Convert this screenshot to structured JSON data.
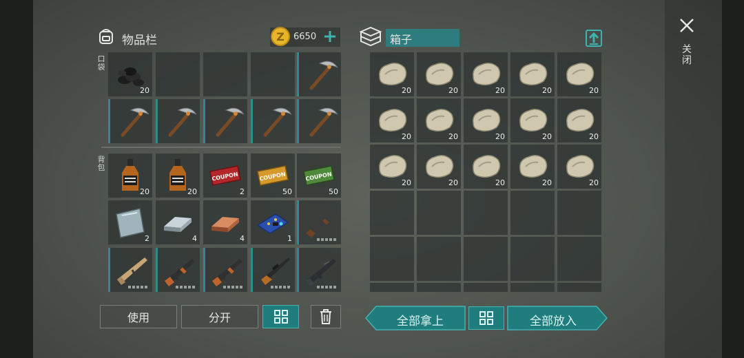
{
  "inventory": {
    "title": "物品栏",
    "coins": "6650",
    "pocket_label": "口袋",
    "backpack_label": "背包",
    "pocket": [
      {
        "icon": "coal-icon",
        "qty": "20",
        "accent": false
      },
      {
        "icon": "empty",
        "qty": "",
        "accent": false
      },
      {
        "icon": "empty",
        "qty": "",
        "accent": false
      },
      {
        "icon": "empty",
        "qty": "",
        "accent": false
      },
      {
        "icon": "pickaxe-icon",
        "qty": "",
        "accent": true
      },
      {
        "icon": "pickaxe-icon",
        "qty": "",
        "accent": true
      },
      {
        "icon": "pickaxe-icon",
        "qty": "",
        "accent": true
      },
      {
        "icon": "pickaxe-icon",
        "qty": "",
        "accent": true
      },
      {
        "icon": "pickaxe-icon",
        "qty": "",
        "accent": true
      },
      {
        "icon": "pickaxe-icon",
        "qty": "",
        "accent": true
      }
    ],
    "backpack": [
      {
        "icon": "whiskey-bottle-icon",
        "qty": "20",
        "accent": false
      },
      {
        "icon": "whiskey-bottle-icon",
        "qty": "20",
        "accent": false
      },
      {
        "icon": "red-coupon-icon",
        "qty": "2",
        "accent": false
      },
      {
        "icon": "orange-coupon-icon",
        "qty": "50",
        "accent": false
      },
      {
        "icon": "green-coupon-icon",
        "qty": "50",
        "accent": false
      },
      {
        "icon": "metal-plate-icon",
        "qty": "2",
        "accent": false
      },
      {
        "icon": "iron-ingot-icon",
        "qty": "4",
        "accent": false
      },
      {
        "icon": "copper-ingot-icon",
        "qty": "4",
        "accent": false
      },
      {
        "icon": "circuit-board-icon",
        "qty": "1",
        "accent": false
      },
      {
        "icon": "shotgun-icon",
        "qty": "",
        "accent": true,
        "dots": true
      },
      {
        "icon": "rifle-tan-icon",
        "qty": "",
        "accent": true,
        "dots": true
      },
      {
        "icon": "ak-rifle-icon",
        "qty": "",
        "accent": true,
        "dots": true
      },
      {
        "icon": "ak-rifle-icon",
        "qty": "",
        "accent": true,
        "dots": true
      },
      {
        "icon": "hunting-rifle-icon",
        "qty": "",
        "accent": true,
        "dots": true
      },
      {
        "icon": "assault-rifle-icon",
        "qty": "",
        "accent": true,
        "dots": true
      }
    ],
    "coupon_text": "COUPON"
  },
  "chest": {
    "title": "箱子",
    "items": [
      {
        "icon": "stone-icon",
        "qty": "20"
      },
      {
        "icon": "stone-icon",
        "qty": "20"
      },
      {
        "icon": "stone-icon",
        "qty": "20"
      },
      {
        "icon": "stone-icon",
        "qty": "20"
      },
      {
        "icon": "stone-icon",
        "qty": "20"
      },
      {
        "icon": "stone-icon",
        "qty": "20"
      },
      {
        "icon": "stone-icon",
        "qty": "20"
      },
      {
        "icon": "stone-icon",
        "qty": "20"
      },
      {
        "icon": "stone-icon",
        "qty": "20"
      },
      {
        "icon": "stone-icon",
        "qty": "20"
      },
      {
        "icon": "stone-icon",
        "qty": "20"
      },
      {
        "icon": "stone-icon",
        "qty": "20"
      },
      {
        "icon": "stone-icon",
        "qty": "20"
      },
      {
        "icon": "stone-icon",
        "qty": "20"
      },
      {
        "icon": "stone-icon",
        "qty": "20"
      }
    ],
    "total_rows": 6
  },
  "buttons": {
    "use": "使用",
    "split": "分开",
    "take_all": "全部拿上",
    "put_all": "全部放入",
    "close": "关闭"
  },
  "colors": {
    "accent": "#2d8c8e",
    "teal_button": "#1f7d7d",
    "coin": "#e7b52a"
  }
}
